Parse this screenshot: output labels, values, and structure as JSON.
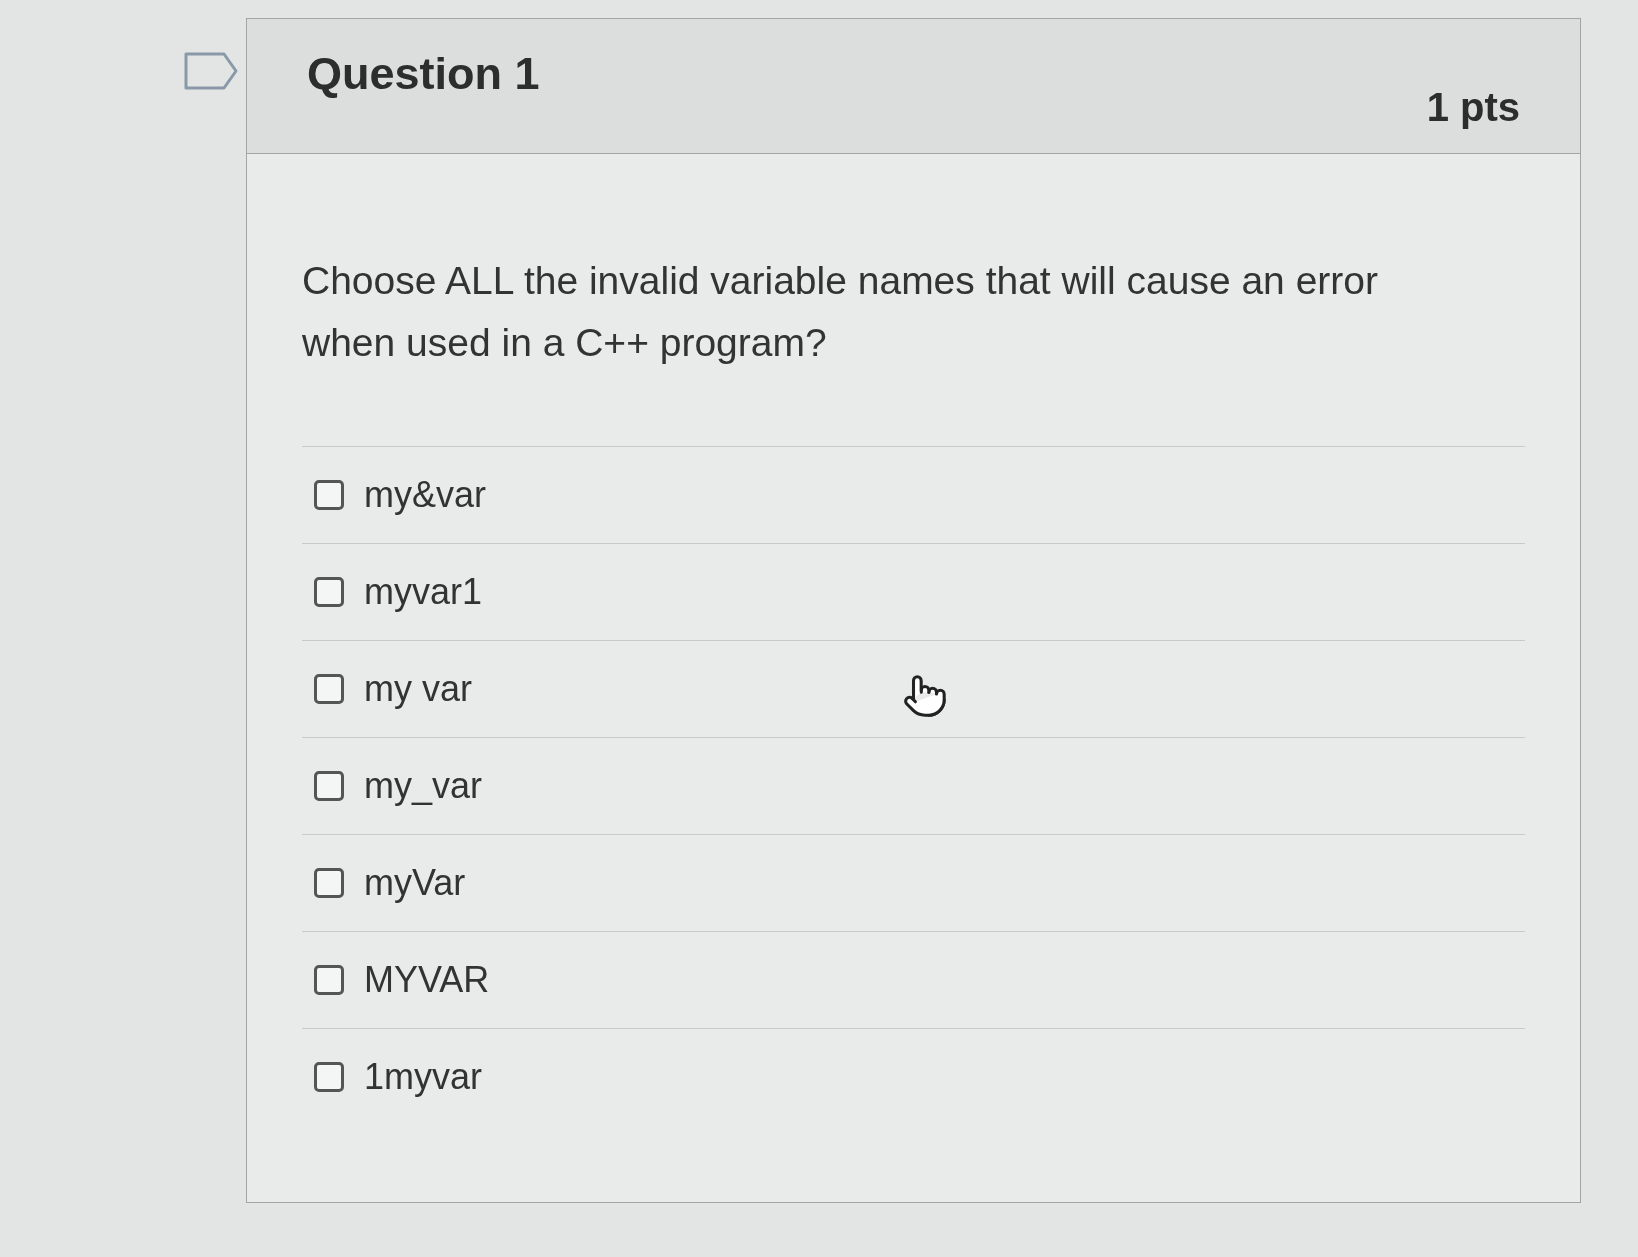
{
  "question": {
    "title": "Question 1",
    "points": "1 pts",
    "text": "Choose ALL the invalid variable names that will cause an error when used in a C++ program?",
    "options": [
      {
        "label": "my&var",
        "checked": false
      },
      {
        "label": "myvar1",
        "checked": false
      },
      {
        "label": "my var",
        "checked": false
      },
      {
        "label": "my_var",
        "checked": false
      },
      {
        "label": "myVar",
        "checked": false
      },
      {
        "label": "MYVAR",
        "checked": false
      },
      {
        "label": "1myvar",
        "checked": false
      }
    ]
  }
}
